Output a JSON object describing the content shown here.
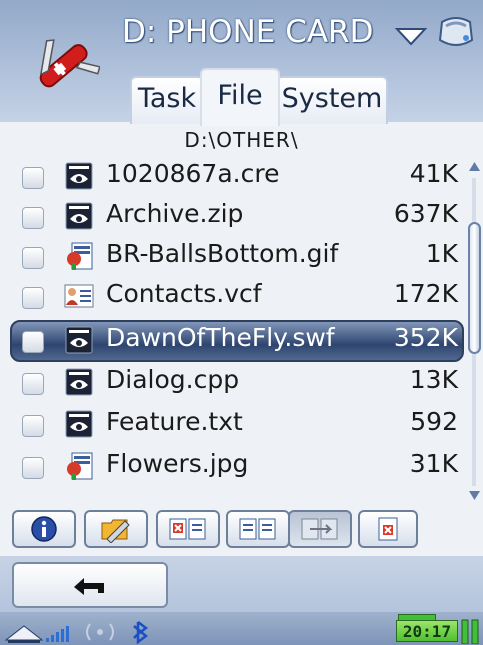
{
  "header": {
    "drive_title": "D: PHONE CARD",
    "tabs": [
      {
        "label": "Task",
        "active": false
      },
      {
        "label": "File",
        "active": true
      },
      {
        "label": "System",
        "active": false
      }
    ]
  },
  "path": "D:\\OTHER\\",
  "files": [
    {
      "name": "1020867a.cre",
      "size": "41K",
      "icon": "generic-file-icon",
      "selected": false
    },
    {
      "name": "Archive.zip",
      "size": "637K",
      "icon": "generic-file-icon",
      "selected": false
    },
    {
      "name": "BR-BallsBottom.gif",
      "size": "1K",
      "icon": "image-file-icon",
      "selected": false
    },
    {
      "name": "Contacts.vcf",
      "size": "172K",
      "icon": "contact-card-icon",
      "selected": false
    },
    {
      "name": "DawnOfTheFly.swf",
      "size": "352K",
      "icon": "generic-file-icon",
      "selected": true
    },
    {
      "name": "Dialog.cpp",
      "size": "13K",
      "icon": "generic-file-icon",
      "selected": false
    },
    {
      "name": "Feature.txt",
      "size": "592",
      "icon": "generic-file-icon",
      "selected": false
    },
    {
      "name": "Flowers.jpg",
      "size": "31K",
      "icon": "image-file-icon",
      "selected": false
    }
  ],
  "scrollbar": {
    "position": 0.2
  },
  "toolbar": {
    "buttons": [
      "info-icon",
      "rename-icon",
      "delete-files-icon",
      "copy-icon",
      "move-icon",
      "delete-icon"
    ]
  },
  "status": {
    "time": "20:17"
  },
  "colors": {
    "header": "#a9bcd7",
    "selection": "#2e4570",
    "clock_bg": "#4fbf2e"
  }
}
